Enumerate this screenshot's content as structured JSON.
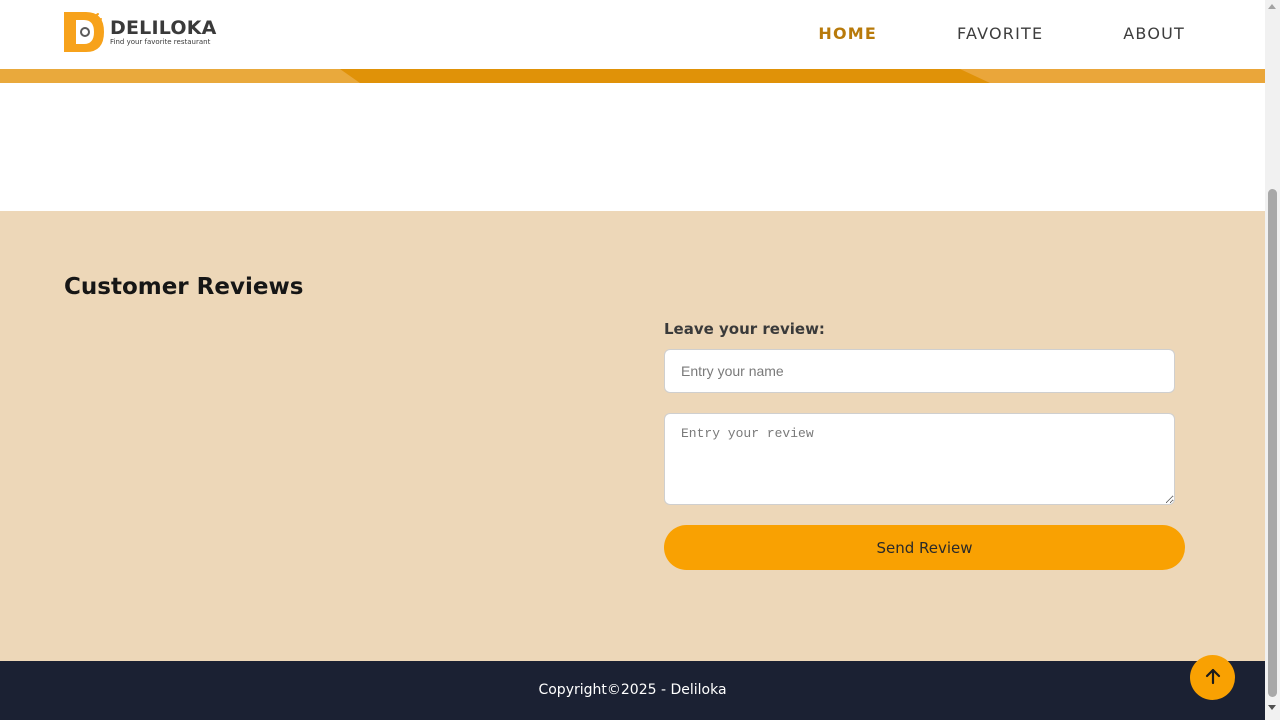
{
  "header": {
    "logo": {
      "name": "DELILOKA",
      "tagline": "Find your favorite restaurant"
    },
    "nav": [
      {
        "label": "HOME",
        "active": true
      },
      {
        "label": "FAVORITE",
        "active": false
      },
      {
        "label": "ABOUT",
        "active": false
      }
    ]
  },
  "reviews": {
    "title": "Customer Reviews",
    "form_label": "Leave your review:",
    "name_placeholder": "Entry your name",
    "review_placeholder": "Entry your review",
    "submit_label": "Send Review"
  },
  "footer": {
    "copyright": "Copyright©2025 - Deliloka"
  },
  "icons": {
    "to_top": "arrow-up-icon",
    "logo": "deliloka-logo-icon"
  },
  "colors": {
    "accent": "#f9a102",
    "nav_active": "#b87a0a",
    "section_bg": "#edd7b8",
    "footer_bg": "#1b2133",
    "band": "#e09208"
  }
}
